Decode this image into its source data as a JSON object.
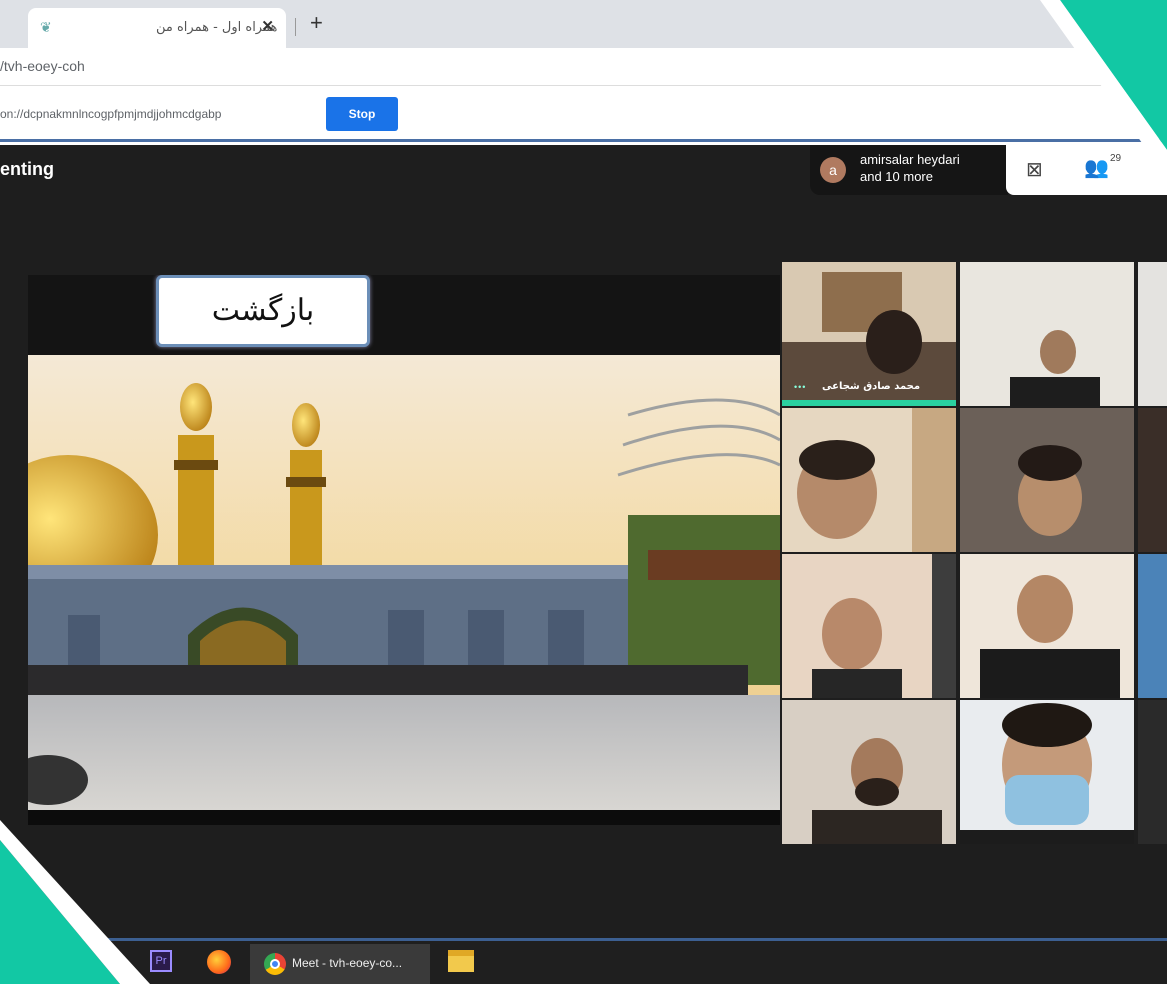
{
  "browser": {
    "tab_title": "همراه اول - همراه من",
    "url": "/tvh-eoey-coh",
    "share_bar_text": "on://dcpnakmnlncogpfpmjmdjjohmcdgabp",
    "stop_label": "Stop"
  },
  "meet": {
    "presenting_label": "enting",
    "chip_avatar_letter": "a",
    "chip_name_line1": "amirsalar heydari",
    "chip_name_line2": "and 10 more",
    "participants_count": "29"
  },
  "slide": {
    "back_button_text": "بازگشت"
  },
  "participants": [
    {
      "label": "محمد صادق شجاعی",
      "dots": "•••"
    }
  ],
  "taskbar": {
    "premiere_label": "Pr",
    "chrome_label": "Meet - tvh-eoey-co..."
  },
  "icons": {
    "grid_layout": "grid-icon",
    "people": "people-icon",
    "close_tab": "close-icon",
    "new_tab": "plus-icon"
  }
}
